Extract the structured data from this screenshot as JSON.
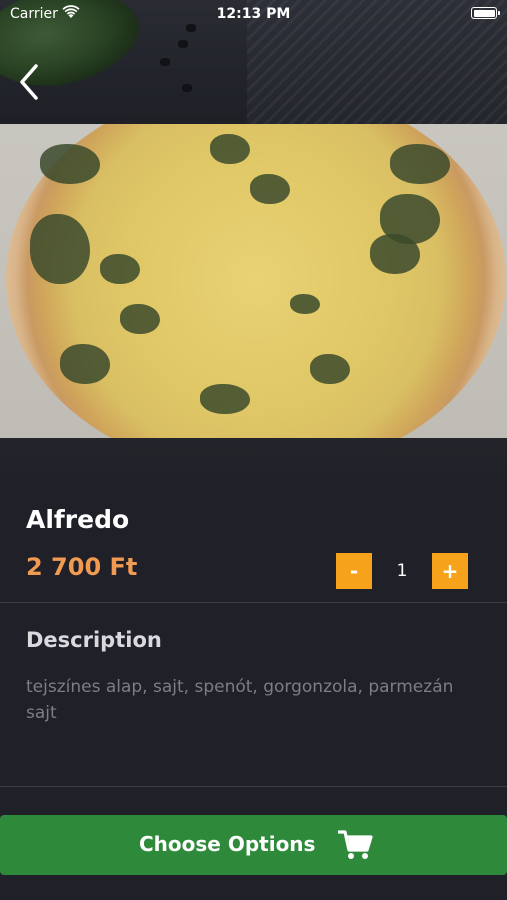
{
  "status_bar": {
    "carrier": "Carrier",
    "time": "12:13 PM"
  },
  "navigation": {
    "back_icon": "chevron-left-icon"
  },
  "hero": {
    "subject": "pizza-image"
  },
  "product": {
    "name": "Alfredo",
    "price": "2 700 Ft",
    "quantity": "1",
    "minus_label": "-",
    "plus_label": "+"
  },
  "description": {
    "heading": "Description",
    "text": "tejszínes alap, sajt, spenót, gorgonzola, parmezán sajt"
  },
  "actions": {
    "choose_options_label": "Choose Options",
    "cart_icon": "shopping-cart-icon"
  },
  "colors": {
    "background": "#1f2028",
    "price": "#f19a52",
    "quantity_buttons": "#f7a21b",
    "primary_button": "#2e8a3a"
  }
}
